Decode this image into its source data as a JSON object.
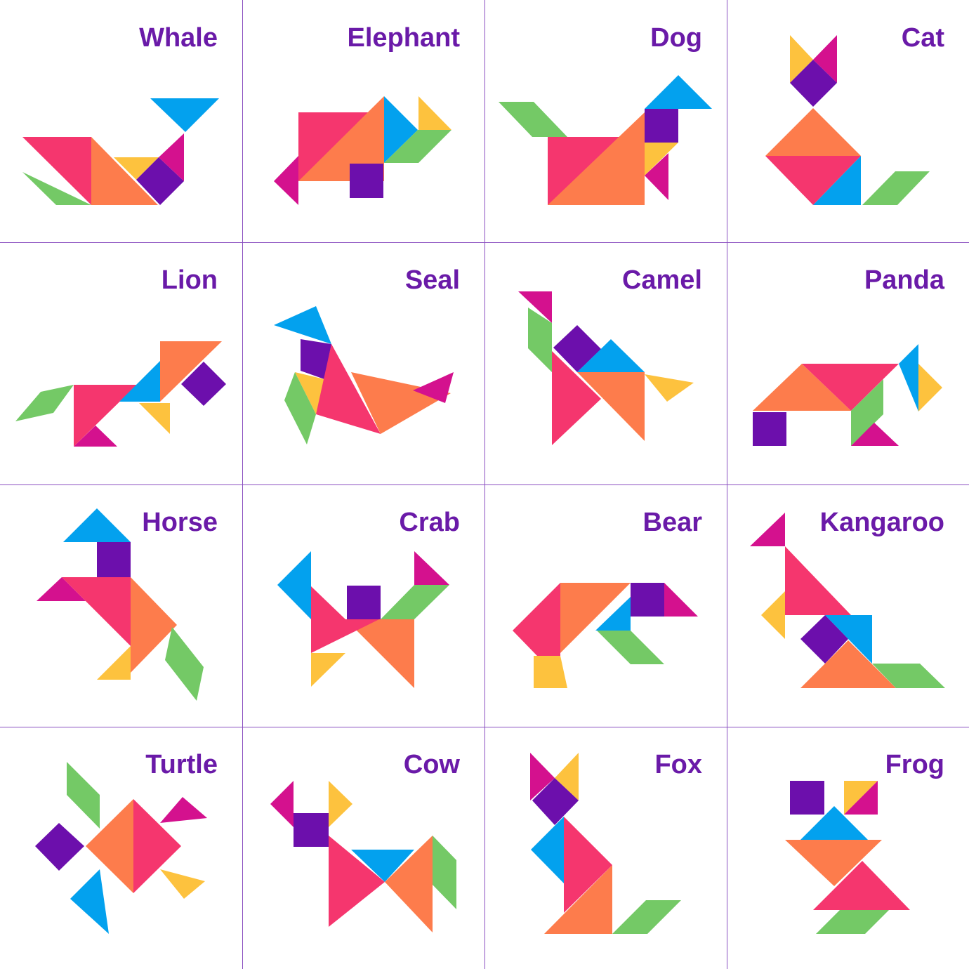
{
  "colors": {
    "title": "#6a1aa8",
    "grid_line": "#8a4fc0",
    "pink": "#f5366e",
    "orange": "#fd7c4c",
    "blue": "#03a1ee",
    "purple": "#6c0fac",
    "magenta": "#d4118e",
    "yellow": "#fdc23e",
    "green": "#74c966"
  },
  "animals": [
    {
      "id": "whale",
      "label": "Whale"
    },
    {
      "id": "elephant",
      "label": "Elephant"
    },
    {
      "id": "dog",
      "label": "Dog"
    },
    {
      "id": "cat",
      "label": "Cat"
    },
    {
      "id": "lion",
      "label": "Lion"
    },
    {
      "id": "seal",
      "label": "Seal"
    },
    {
      "id": "camel",
      "label": "Camel"
    },
    {
      "id": "panda",
      "label": "Panda"
    },
    {
      "id": "horse",
      "label": "Horse"
    },
    {
      "id": "crab",
      "label": "Crab"
    },
    {
      "id": "bear",
      "label": "Bear"
    },
    {
      "id": "kangaroo",
      "label": "Kangaroo"
    },
    {
      "id": "turtle",
      "label": "Turtle"
    },
    {
      "id": "cow",
      "label": "Cow"
    },
    {
      "id": "fox",
      "label": "Fox"
    },
    {
      "id": "frog",
      "label": "Frog"
    }
  ]
}
